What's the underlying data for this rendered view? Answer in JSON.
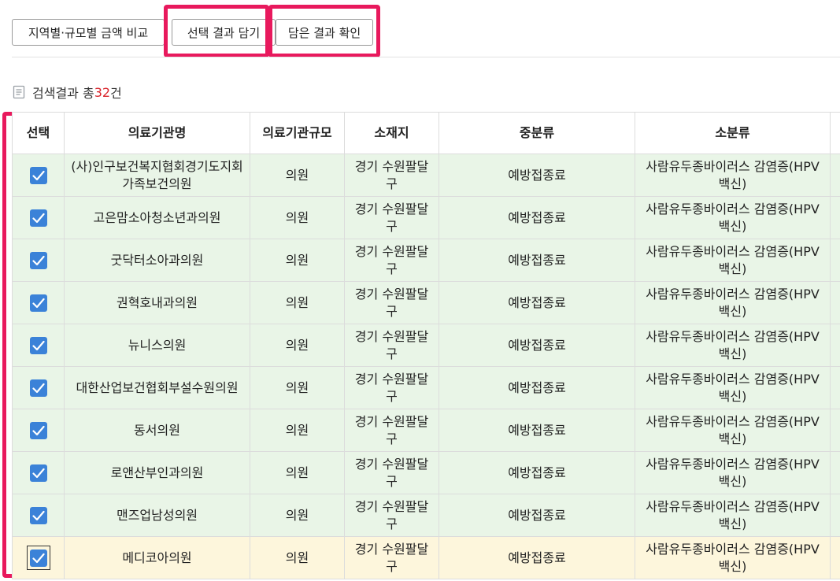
{
  "toolbar": {
    "compare_label": "지역별·규모별 금액 비교",
    "add_label": "선택 결과 담기",
    "view_label": "담은 결과 확인"
  },
  "result": {
    "prefix": "검색결과 총",
    "count": "32",
    "suffix": "건"
  },
  "table": {
    "headers": [
      "선택",
      "의료기관명",
      "의료기관규모",
      "소재지",
      "중분류",
      "소분류"
    ],
    "rows": [
      {
        "checked": true,
        "name": "(사)인구보건복지협회경기도지회가족보건의원",
        "size": "의원",
        "location": "경기 수원팔달구",
        "middle": "예방접종료",
        "sub": "사람유두종바이러스 감염증(HPV 백신)"
      },
      {
        "checked": true,
        "name": "고은맘소아청소년과의원",
        "size": "의원",
        "location": "경기 수원팔달구",
        "middle": "예방접종료",
        "sub": "사람유두종바이러스 감염증(HPV 백신)"
      },
      {
        "checked": true,
        "name": "굿닥터소아과의원",
        "size": "의원",
        "location": "경기 수원팔달구",
        "middle": "예방접종료",
        "sub": "사람유두종바이러스 감염증(HPV 백신)"
      },
      {
        "checked": true,
        "name": "권혁호내과의원",
        "size": "의원",
        "location": "경기 수원팔달구",
        "middle": "예방접종료",
        "sub": "사람유두종바이러스 감염증(HPV 백신)"
      },
      {
        "checked": true,
        "name": "뉴니스의원",
        "size": "의원",
        "location": "경기 수원팔달구",
        "middle": "예방접종료",
        "sub": "사람유두종바이러스 감염증(HPV 백신)"
      },
      {
        "checked": true,
        "name": "대한산업보건협회부설수원의원",
        "size": "의원",
        "location": "경기 수원팔달구",
        "middle": "예방접종료",
        "sub": "사람유두종바이러스 감염증(HPV 백신)"
      },
      {
        "checked": true,
        "name": "동서의원",
        "size": "의원",
        "location": "경기 수원팔달구",
        "middle": "예방접종료",
        "sub": "사람유두종바이러스 감염증(HPV 백신)"
      },
      {
        "checked": true,
        "name": "로앤산부인과의원",
        "size": "의원",
        "location": "경기 수원팔달구",
        "middle": "예방접종료",
        "sub": "사람유두종바이러스 감염증(HPV 백신)"
      },
      {
        "checked": true,
        "name": "맨즈업남성의원",
        "size": "의원",
        "location": "경기 수원팔달구",
        "middle": "예방접종료",
        "sub": "사람유두종바이러스 감염증(HPV 백신)"
      },
      {
        "checked": true,
        "name": "메디코아의원",
        "size": "의원",
        "location": "경기 수원팔달구",
        "middle": "예방접종료",
        "sub": "사람유두종바이러스 감염증(HPV 백신)"
      }
    ]
  },
  "colors": {
    "highlight": "#e8195d",
    "checkbox": "#3b82d8",
    "row_selected": "#e9f5e7",
    "row_hover": "#fdf6dc",
    "count": "#d9262d"
  }
}
